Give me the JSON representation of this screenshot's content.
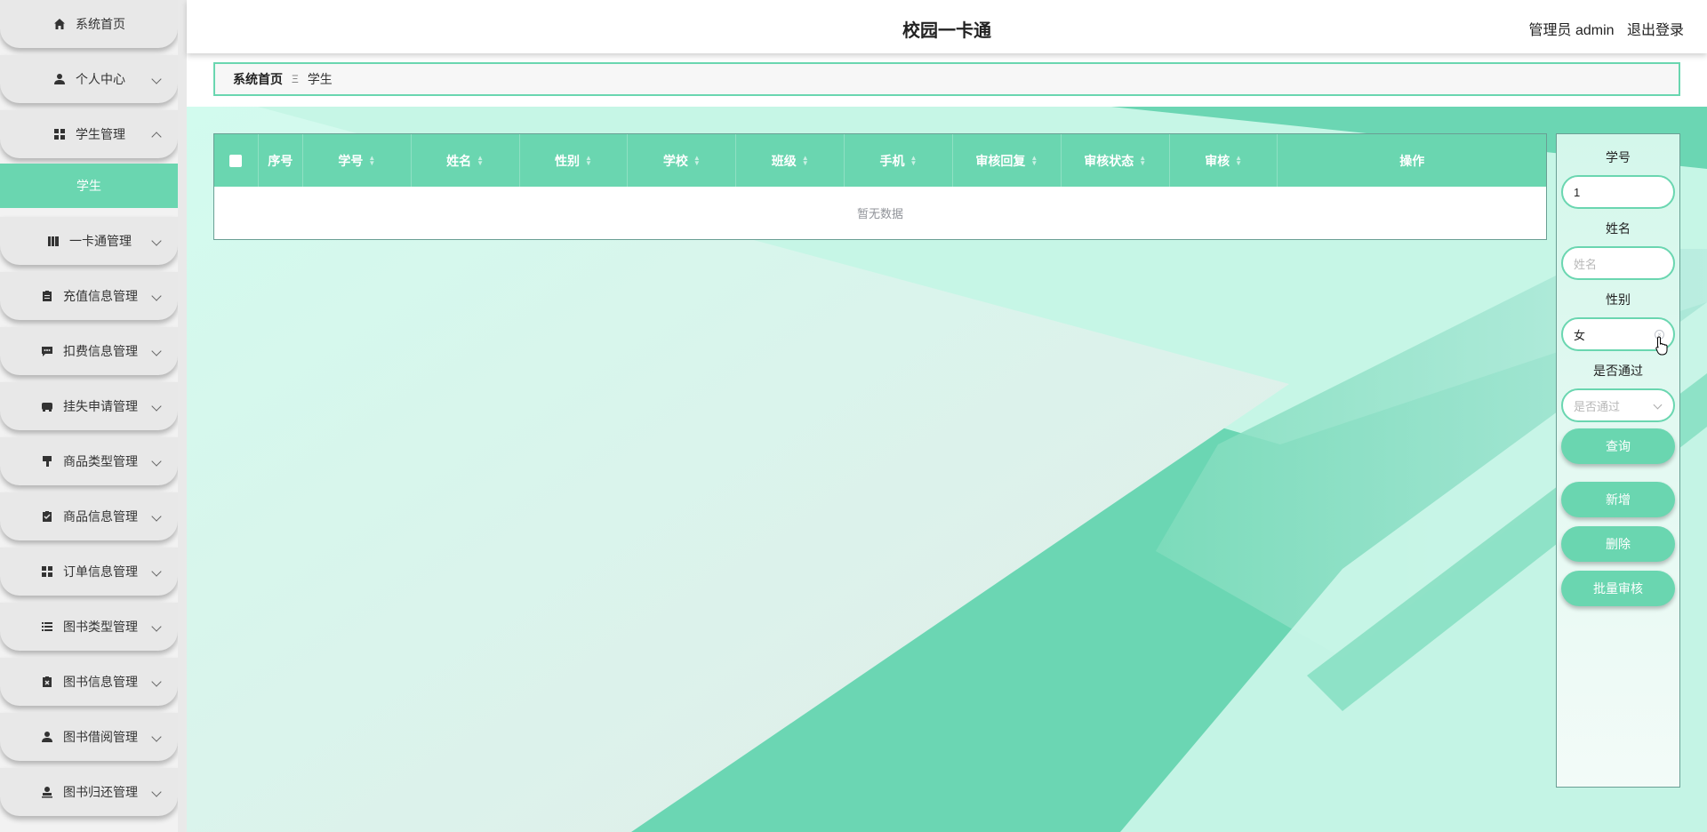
{
  "header": {
    "title": "校园一卡通",
    "user_role": "管理员 admin",
    "logout": "退出登录"
  },
  "sidebar": {
    "items": [
      {
        "label": "系统首页",
        "icon": "home-icon"
      },
      {
        "label": "个人中心",
        "icon": "user-icon"
      },
      {
        "label": "学生管理",
        "icon": "grid-icon"
      },
      {
        "label": "一卡通管理",
        "icon": "book-icon"
      },
      {
        "label": "充值信息管理",
        "icon": "clipboard-icon"
      },
      {
        "label": "扣费信息管理",
        "icon": "chat-icon"
      },
      {
        "label": "挂失申请管理",
        "icon": "card-icon"
      },
      {
        "label": "商品类型管理",
        "icon": "brush-icon"
      },
      {
        "label": "商品信息管理",
        "icon": "check-clipboard-icon"
      },
      {
        "label": "订单信息管理",
        "icon": "grid-icon"
      },
      {
        "label": "图书类型管理",
        "icon": "list-icon"
      },
      {
        "label": "图书信息管理",
        "icon": "x-clipboard-icon"
      },
      {
        "label": "图书借阅管理",
        "icon": "person-icon"
      },
      {
        "label": "图书归还管理",
        "icon": "stamp-icon"
      }
    ],
    "sub_item": "学生"
  },
  "breadcrumb": {
    "home": "系统首页",
    "separator": "Ξ",
    "current": "学生"
  },
  "table": {
    "columns": [
      "序号",
      "学号",
      "姓名",
      "性别",
      "学校",
      "班级",
      "手机",
      "审核回复",
      "审核状态",
      "审核",
      "操作"
    ],
    "empty_text": "暂无数据"
  },
  "search": {
    "student_no_label": "学号",
    "student_no_value": "1",
    "name_label": "姓名",
    "name_placeholder": "姓名",
    "gender_label": "性别",
    "gender_value": "女",
    "passed_label": "是否通过",
    "passed_placeholder": "是否通过",
    "query_button": "查询",
    "add_button": "新增",
    "delete_button": "删除",
    "batch_review_button": "批量审核"
  },
  "colors": {
    "accent": "#6ad6b0",
    "sidebar_bg": "#e8e8e8"
  }
}
